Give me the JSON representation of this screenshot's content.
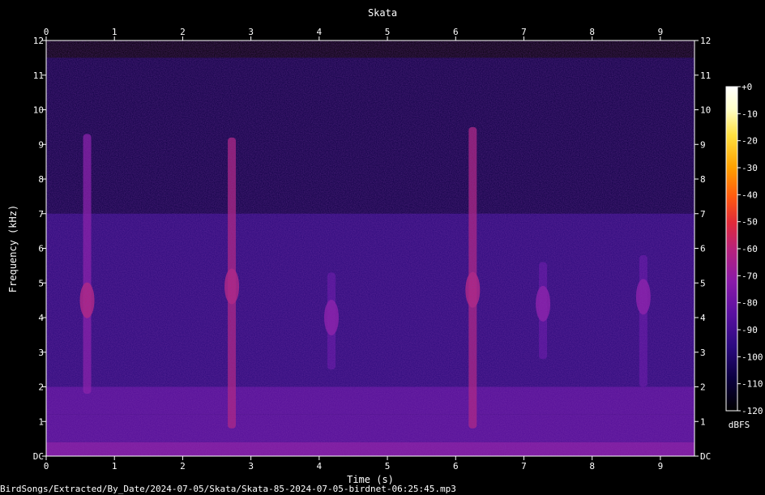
{
  "chart_data": {
    "type": "heatmap",
    "title": "Skata",
    "xlabel": "Time (s)",
    "ylabel": "Frequency (kHz)",
    "xlim": [
      0,
      9.5
    ],
    "ylim": [
      0,
      12
    ],
    "x_ticks": [
      "0",
      "1",
      "2",
      "3",
      "4",
      "5",
      "6",
      "7",
      "8",
      "9"
    ],
    "y_ticks": [
      "DC",
      "1",
      "2",
      "3",
      "4",
      "5",
      "6",
      "7",
      "8",
      "9",
      "10",
      "11",
      "12"
    ],
    "colorbar": {
      "label": "dBFS",
      "ticks": [
        "+0",
        "-10",
        "-20",
        "-30",
        "-40",
        "-50",
        "-60",
        "-70",
        "-80",
        "-90",
        "-100",
        "-110",
        "-120"
      ],
      "range": [
        -120,
        0
      ],
      "colors": [
        "#000000",
        "#0b0040",
        "#2c0a80",
        "#5a10a0",
        "#8a1aa8",
        "#b8227a",
        "#e02a3a",
        "#ff5a10",
        "#ffa000",
        "#ffe040",
        "#ffffc8",
        "#ffffff"
      ]
    },
    "calls": [
      {
        "t": 0.6,
        "f_low": 1.8,
        "f_high": 9.3,
        "peak_khz": 4.5,
        "level_dbfs": -65
      },
      {
        "t": 2.72,
        "f_low": 0.8,
        "f_high": 9.2,
        "peak_khz": 4.9,
        "level_dbfs": -62
      },
      {
        "t": 4.18,
        "f_low": 2.5,
        "f_high": 5.3,
        "peak_khz": 4.0,
        "level_dbfs": -75
      },
      {
        "t": 6.25,
        "f_low": 0.8,
        "f_high": 9.5,
        "peak_khz": 4.8,
        "level_dbfs": -62
      },
      {
        "t": 7.28,
        "f_low": 2.8,
        "f_high": 5.6,
        "peak_khz": 4.4,
        "level_dbfs": -76
      },
      {
        "t": 8.75,
        "f_low": 2.0,
        "f_high": 5.8,
        "peak_khz": 4.6,
        "level_dbfs": -78
      }
    ],
    "noise_floor_dbfs": -100,
    "low_freq_band_khz": [
      0,
      1.2
    ]
  },
  "footer": {
    "file_path": "BirdSongs/Extracted/By_Date/2024-07-05/Skata/Skata-85-2024-07-05-birdnet-06:25:45.mp3"
  }
}
